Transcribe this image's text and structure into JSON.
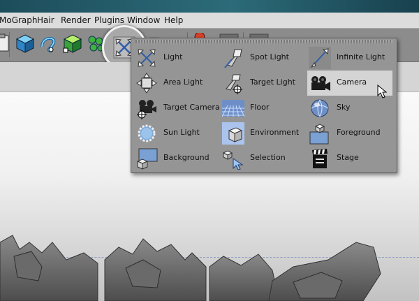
{
  "menubar": {
    "items": [
      "MoGraph",
      "Hair",
      "Render",
      "Plugins",
      "Window",
      "Help"
    ]
  },
  "toolbar": {
    "icons": [
      "paste-icon",
      "cube-icon",
      "spline-icon",
      "nurbs-icon",
      "mograph-cloner-icon",
      "light-tool-icon",
      "deformer-icon",
      "render-icon",
      "render-settings-icon"
    ]
  },
  "palette": {
    "items": [
      {
        "label": "Light",
        "icon": "light-icon"
      },
      {
        "label": "Spot Light",
        "icon": "spot-light-icon"
      },
      {
        "label": "Infinite Light",
        "icon": "infinite-light-icon"
      },
      {
        "label": "Area Light",
        "icon": "area-light-icon"
      },
      {
        "label": "Target Light",
        "icon": "target-light-icon"
      },
      {
        "label": "Camera",
        "icon": "camera-icon"
      },
      {
        "label": "Target Camera",
        "icon": "target-camera-icon"
      },
      {
        "label": "Floor",
        "icon": "floor-icon"
      },
      {
        "label": "Sky",
        "icon": "sky-icon"
      },
      {
        "label": "Sun Light",
        "icon": "sun-light-icon"
      },
      {
        "label": "Environment",
        "icon": "environment-icon"
      },
      {
        "label": "Foreground",
        "icon": "foreground-icon"
      },
      {
        "label": "Background",
        "icon": "background-icon"
      },
      {
        "label": "Selection",
        "icon": "selection-icon"
      },
      {
        "label": "Stage",
        "icon": "stage-icon"
      }
    ],
    "highlighted": "Camera"
  }
}
